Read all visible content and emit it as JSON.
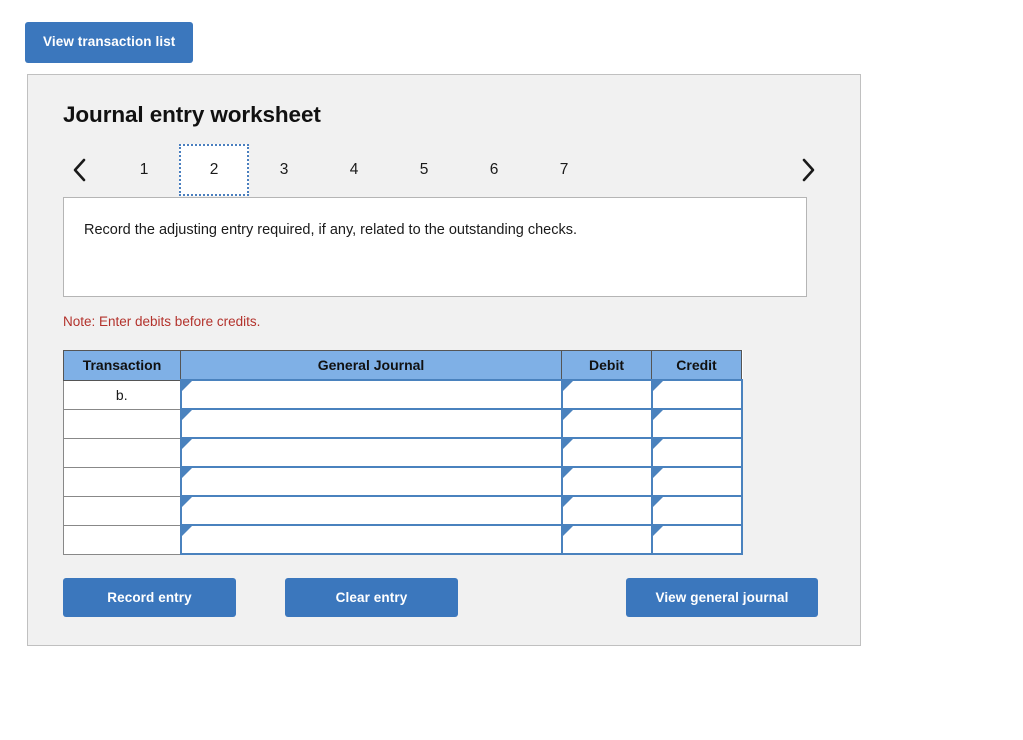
{
  "top": {
    "view_transaction_list_label": "View transaction list"
  },
  "panel": {
    "title": "Journal entry worksheet"
  },
  "pager": {
    "prev_icon": "chevron-left-icon",
    "next_icon": "chevron-right-icon",
    "active_index": 1,
    "tabs": [
      {
        "label": "1",
        "active": false
      },
      {
        "label": "2",
        "active": true
      },
      {
        "label": "3",
        "active": false
      },
      {
        "label": "4",
        "active": false
      },
      {
        "label": "5",
        "active": false
      },
      {
        "label": "6",
        "active": false
      },
      {
        "label": "7",
        "active": false
      }
    ]
  },
  "instruction": {
    "text": "Record the adjusting entry required, if any, related to the outstanding checks."
  },
  "note": {
    "text": "Note: Enter debits before credits."
  },
  "table": {
    "headers": [
      "Transaction",
      "General Journal",
      "Debit",
      "Credit"
    ],
    "rows": [
      {
        "transaction": "b.",
        "general_journal": "",
        "debit": "",
        "credit": ""
      },
      {
        "transaction": "",
        "general_journal": "",
        "debit": "",
        "credit": ""
      },
      {
        "transaction": "",
        "general_journal": "",
        "debit": "",
        "credit": ""
      },
      {
        "transaction": "",
        "general_journal": "",
        "debit": "",
        "credit": ""
      },
      {
        "transaction": "",
        "general_journal": "",
        "debit": "",
        "credit": ""
      },
      {
        "transaction": "",
        "general_journal": "",
        "debit": "",
        "credit": ""
      }
    ]
  },
  "actions": {
    "record_entry_label": "Record entry",
    "clear_entry_label": "Clear entry",
    "view_general_journal_label": "View general journal"
  },
  "colors": {
    "accent_blue": "#3b77bd",
    "header_blue": "#7fb0e6",
    "cell_border_blue": "#4a82be",
    "note_red": "#b3322c",
    "panel_bg": "#f1f1f1"
  }
}
